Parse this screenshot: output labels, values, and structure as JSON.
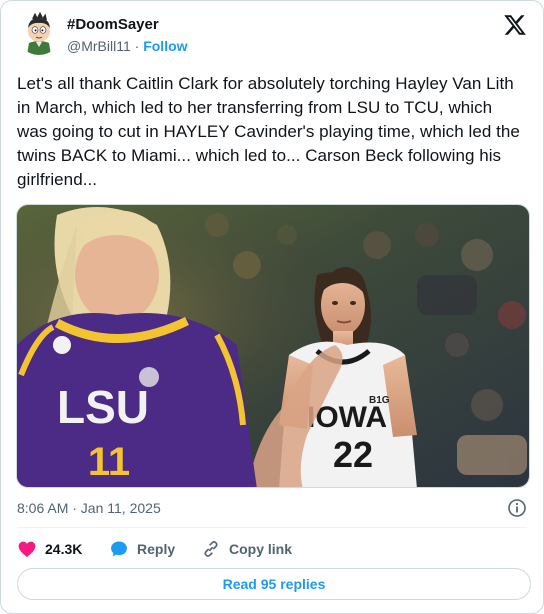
{
  "author": {
    "display_name": "#DoomSayer",
    "handle": "@MrBill11",
    "separator": "·",
    "follow_label": "Follow",
    "avatar_icon": "cartoon-character-avatar"
  },
  "tweet": {
    "text": "Let's all thank Caitlin Clark for absolutely torching Hayley Van Lith in March, which led to her transferring from LSU to TCU, which was going to cut in HAYLEY Cavinder's playing time, which led the twins BACK to Miami... which led to... Carson Beck following his girlfriend...",
    "timestamp": "8:06 AM · Jan 11, 2025"
  },
  "media": {
    "left_jersey_text": "LSU",
    "left_jersey_number": "11",
    "right_jersey_text": "IOWA",
    "right_jersey_number": "22",
    "right_jersey_logo": "B1G"
  },
  "actions": {
    "likes_count": "24.3K",
    "reply_label": "Reply",
    "copy_link_label": "Copy link"
  },
  "footer": {
    "read_replies_label": "Read 95 replies"
  },
  "colors": {
    "accent": "#1d9bf0",
    "like": "#f91880",
    "secondary_text": "#536471",
    "border": "#cfd9de"
  }
}
